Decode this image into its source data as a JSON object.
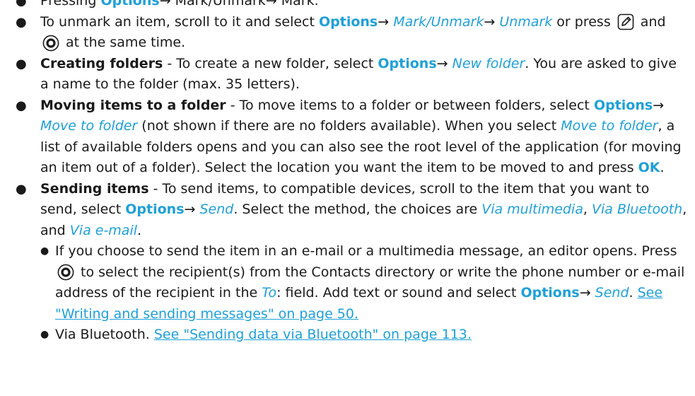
{
  "items": [
    {
      "parts": [
        {
          "t": "Pressing "
        },
        {
          "t": "Options",
          "c": "opt"
        },
        {
          "t": "→ Mark/Unmark→ Mark."
        }
      ]
    },
    {
      "parts": [
        {
          "t": "To unmark an item, scroll to it and select "
        },
        {
          "t": "Options",
          "c": "opt"
        },
        {
          "t": "→ "
        },
        {
          "t": "Mark/Unmark",
          "c": "em"
        },
        {
          "t": "→ "
        },
        {
          "t": "Unmark",
          "c": "em"
        },
        {
          "t": " or press "
        },
        {
          "icon": "edit-key-icon"
        },
        {
          "t": " and "
        },
        {
          "icon": "select-key-icon"
        },
        {
          "t": " at the same time."
        }
      ]
    },
    {
      "parts": [
        {
          "t": "Creating folders",
          "c": "b"
        },
        {
          "t": " - To create a new folder, select "
        },
        {
          "t": "Options",
          "c": "opt"
        },
        {
          "t": "→ "
        },
        {
          "t": "New folder",
          "c": "em"
        },
        {
          "t": ". You are asked to give a name to the folder (max. 35 letters)."
        }
      ]
    },
    {
      "parts": [
        {
          "t": "Moving items to a folder",
          "c": "b"
        },
        {
          "t": " - To move items to a folder or between folders, select "
        },
        {
          "t": "Options",
          "c": "opt"
        },
        {
          "t": "→ "
        },
        {
          "t": "Move to folder",
          "c": "em"
        },
        {
          "t": " (not shown if there are no folders available). When you select "
        },
        {
          "t": "Move to folder",
          "c": "em"
        },
        {
          "t": ", a list of available folders opens and you can also see the root level of the application (for moving an item out of a folder). Select the location you want the item to be moved to and press "
        },
        {
          "t": "OK",
          "c": "opt"
        },
        {
          "t": "."
        }
      ]
    },
    {
      "parts": [
        {
          "t": "Sending items",
          "c": "b"
        },
        {
          "t": " - To send items, to compatible devices, scroll to the item that you want to send, select "
        },
        {
          "t": "Options",
          "c": "opt"
        },
        {
          "t": "→ "
        },
        {
          "t": "Send",
          "c": "em"
        },
        {
          "t": ". Select the method, the choices are "
        },
        {
          "t": "Via multimedia",
          "c": "em"
        },
        {
          "t": ", "
        },
        {
          "t": "Via Bluetooth",
          "c": "em"
        },
        {
          "t": ", and "
        },
        {
          "t": "Via e-mail",
          "c": "em"
        },
        {
          "t": "."
        }
      ],
      "sub": [
        {
          "parts": [
            {
              "t": "If you choose to send the item in an e-mail or a multimedia message, an editor opens. Press "
            },
            {
              "icon": "select-key-icon"
            },
            {
              "t": " to select the recipient(s) from the Contacts directory or write the phone number or e-mail address of the recipient in the "
            },
            {
              "t": "To",
              "c": "em"
            },
            {
              "t": ": field. Add text or sound and select "
            },
            {
              "t": "Options",
              "c": "opt"
            },
            {
              "t": "→ "
            },
            {
              "t": "Send",
              "c": "em"
            },
            {
              "t": ". "
            },
            {
              "t": "See \"Writing and sending messages\" on page 50.",
              "c": "link"
            }
          ]
        },
        {
          "parts": [
            {
              "t": "Via Bluetooth. "
            },
            {
              "t": "See \"Sending data via Bluetooth\" on page 113.",
              "c": "link"
            }
          ]
        }
      ]
    }
  ],
  "icons": {
    "edit_key": "edit-key-icon",
    "select_key": "select-key-icon"
  },
  "colors": {
    "accent": "#1ea0d8",
    "text": "#1a1a1a"
  }
}
